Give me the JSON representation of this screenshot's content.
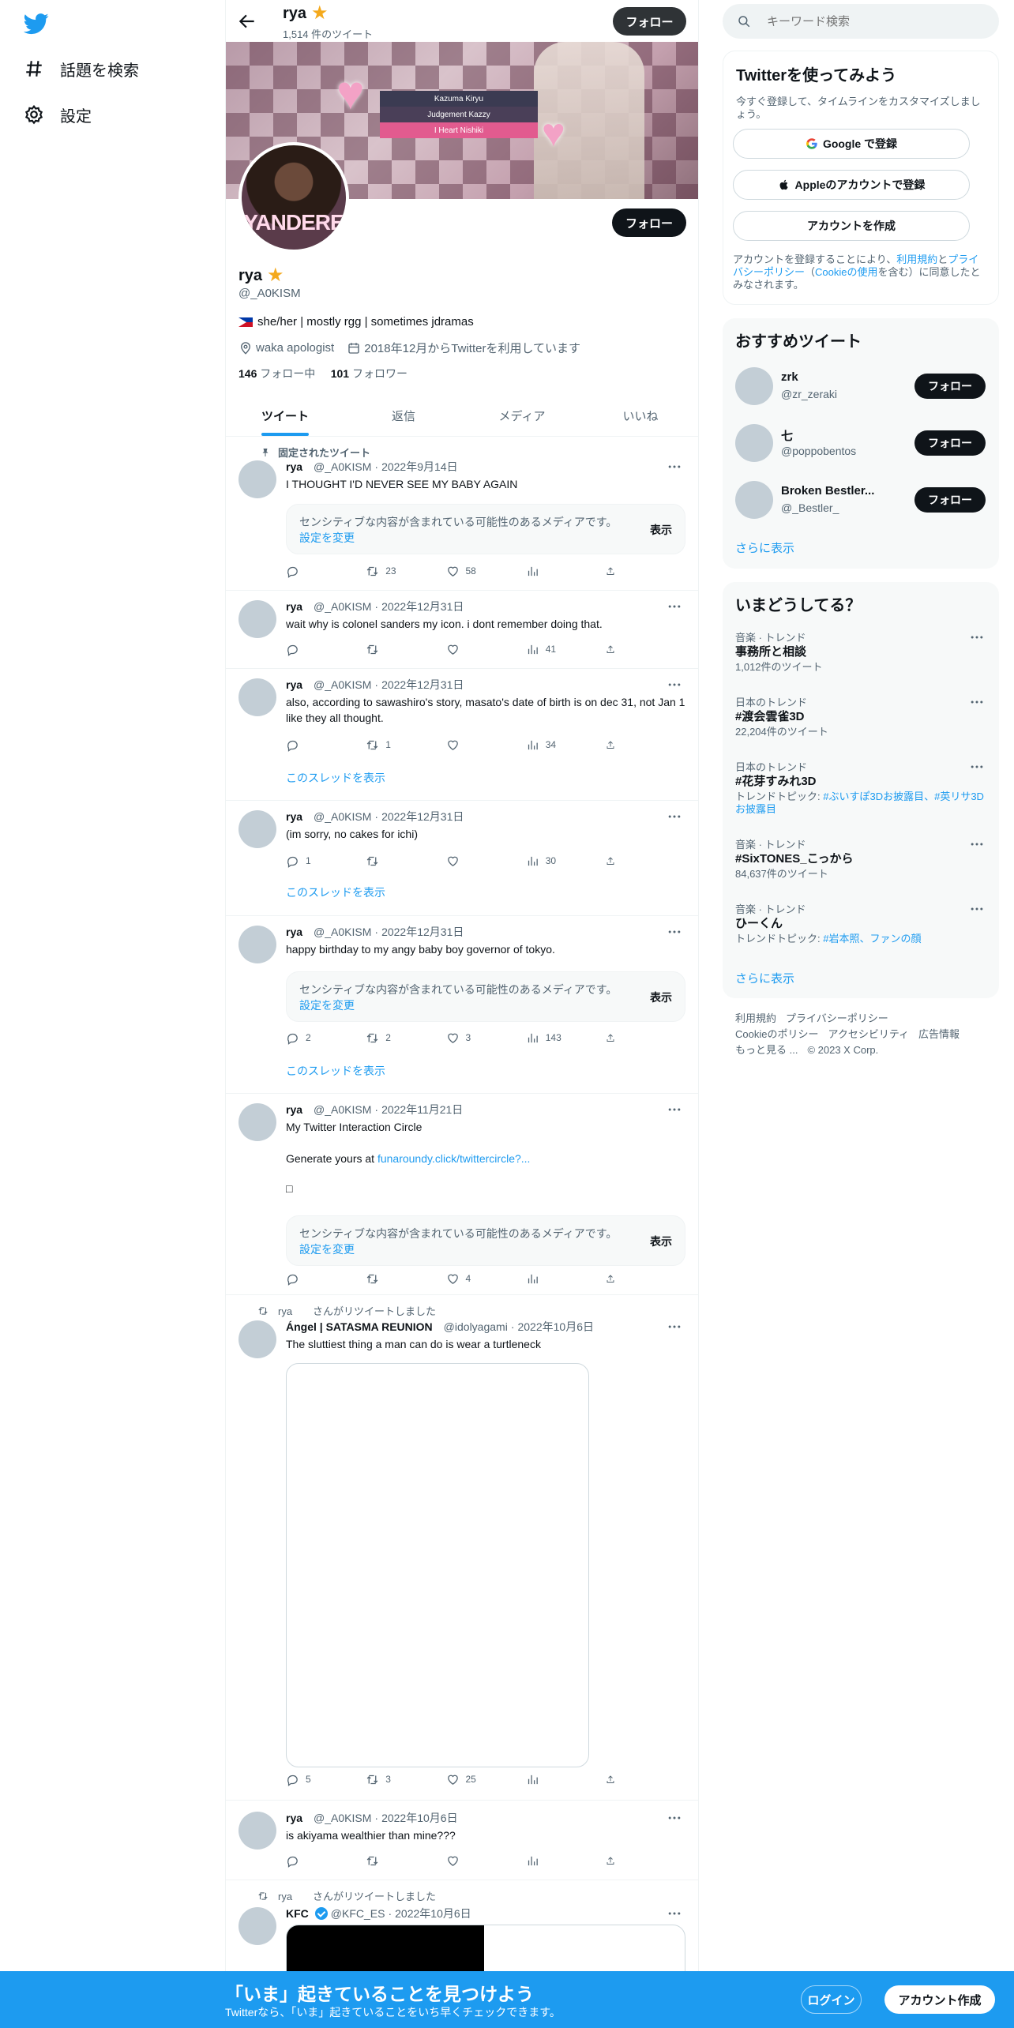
{
  "nav": {
    "explore": "話題を検索",
    "settings": "設定"
  },
  "topbar": {
    "name": "rya",
    "tweet_count": "1,514 件のツイート",
    "follow": "フォロー"
  },
  "banner": {
    "lines": [
      "Kazuma Kiryu",
      "Judgement Kazzy",
      "I Heart Nishiki"
    ]
  },
  "avatar_text": "YANDERE",
  "profile": {
    "follow": "フォロー",
    "name": "rya",
    "handle": "@_A0KISM",
    "bio": "she/her | mostly rgg | sometimes jdramas",
    "location": "waka apologist",
    "joined": "2018年12月からTwitterを利用しています",
    "following_count": "146",
    "following_label": "フォロー中",
    "followers_count": "101",
    "followers_label": "フォロワー"
  },
  "tabs": [
    "ツイート",
    "返信",
    "メディア",
    "いいね"
  ],
  "pinned_label": "固定されたツイート",
  "sensitive": {
    "msg": "センシティブな内容が含まれている可能性のあるメディアです。",
    "link": "設定を変更",
    "show": "表示"
  },
  "thread_link": "このスレッドを表示",
  "tweets": [
    {
      "name": "rya",
      "handle": "@_A0KISM",
      "date": "2022年9月14日",
      "text": "I THOUGHT I'D NEVER SEE MY BABY AGAIN",
      "reply": "",
      "rt": "23",
      "like": "58",
      "views": ""
    },
    {
      "name": "rya",
      "handle": "@_A0KISM",
      "date": "2022年12月31日",
      "text": "wait why is colonel sanders my icon. i dont remember doing that.",
      "reply": "",
      "rt": "",
      "like": "",
      "views": "41"
    },
    {
      "name": "rya",
      "handle": "@_A0KISM",
      "date": "2022年12月31日",
      "text": "also, according to sawashiro's story, masato's date of birth is on dec 31, not Jan 1 like they all thought.",
      "reply": "",
      "rt": "1",
      "like": "",
      "views": "34"
    },
    {
      "name": "rya",
      "handle": "@_A0KISM",
      "date": "2022年12月31日",
      "text": "(im sorry, no cakes for ichi)",
      "reply": "1",
      "rt": "",
      "like": "",
      "views": "30"
    },
    {
      "name": "rya",
      "handle": "@_A0KISM",
      "date": "2022年12月31日",
      "text": "happy birthday to my angy baby boy governor of tokyo.",
      "reply": "2",
      "rt": "2",
      "like": "3",
      "views": "143"
    },
    {
      "name": "rya",
      "handle": "@_A0KISM",
      "date": "2022年11月21日",
      "text": "My Twitter Interaction Circle",
      "text2": "Generate yours at",
      "link": "funaroundy.click/twittercircle?...",
      "text3": "□",
      "reply": "",
      "rt": "",
      "like": "4",
      "views": ""
    },
    {
      "social": "rya　　さんがリツイートしました",
      "name": "Ángel | SATASMA REUNION",
      "handle": "@idolyagami",
      "date": "2022年10月6日",
      "text": "The sluttiest thing a man can do is wear a turtleneck",
      "reply": "5",
      "rt": "3",
      "like": "25",
      "views": ""
    },
    {
      "name": "rya",
      "handle": "@_A0KISM",
      "date": "2022年10月6日",
      "text": "is akiyama wealthier than mine???",
      "reply": "",
      "rt": "",
      "like": "",
      "views": ""
    },
    {
      "social": "rya　　さんがリツイートしました",
      "name": "KFC",
      "handle": "@KFC_ES",
      "date": "2022年10月6日"
    }
  ],
  "right": {
    "search_placeholder": "キーワード検索",
    "signup": {
      "title": "Twitterを使ってみよう",
      "sub": "今すぐ登録して、タイムラインをカスタマイズしましょう。",
      "google": "Google で登録",
      "apple": "Appleのアカウントで登録",
      "create": "アカウントを作成",
      "legal_a": "アカウントを登録することにより、",
      "legal_terms": "利用規約",
      "legal_b": "と",
      "legal_privacy": "プライバシーポリシー",
      "legal_c": "（",
      "legal_cookie": "Cookieの使用",
      "legal_d": "を含む）に同意したとみなされます。"
    },
    "recommend": {
      "title": "おすすめツイート",
      "users": [
        {
          "name": "zrk",
          "handle": "@zr_zeraki",
          "follow": "フォロー"
        },
        {
          "name": "七",
          "handle": "@poppobentos",
          "follow": "フォロー"
        },
        {
          "name": "Broken Bestler...",
          "handle": "@_Bestler_",
          "follow": "フォロー"
        }
      ],
      "more": "さらに表示"
    },
    "trends": {
      "title": "いまどうしてる？",
      "items": [
        {
          "cat": "音楽 · トレンド",
          "title": "事務所と相談",
          "sub": "1,012件のツイート"
        },
        {
          "cat": "日本のトレンド",
          "title": "#渡会雲雀3D",
          "sub": "22,204件のツイート"
        },
        {
          "cat": "日本のトレンド",
          "title": "#花芽すみれ3D",
          "sub_prefix": "トレンドトピック: ",
          "sub_link": "#ぶいすぽ3Dお披露目、#英リサ3Dお披露目"
        },
        {
          "cat": "音楽 · トレンド",
          "title": "#SixTONES_こっから",
          "sub": "84,637件のツイート"
        },
        {
          "cat": "音楽 · トレンド",
          "title": "ひーくん",
          "sub_prefix": "トレンドトピック: ",
          "sub_link": "#岩本照、ファンの顔"
        }
      ],
      "more": "さらに表示"
    },
    "footer": {
      "line1": [
        "利用規約",
        "プライバシーポリシー"
      ],
      "line2": [
        "Cookieのポリシー",
        "アクセシビリティ",
        "広告情報"
      ],
      "line3": [
        "もっと見る ...",
        "© 2023 X Corp."
      ]
    }
  },
  "bottom": {
    "title": "「いま」起きていることを見つけよう",
    "sub": "Twitterなら、「いま」起きていることをいち早くチェックできます。",
    "login": "ログイン",
    "signup": "アカウント作成"
  }
}
